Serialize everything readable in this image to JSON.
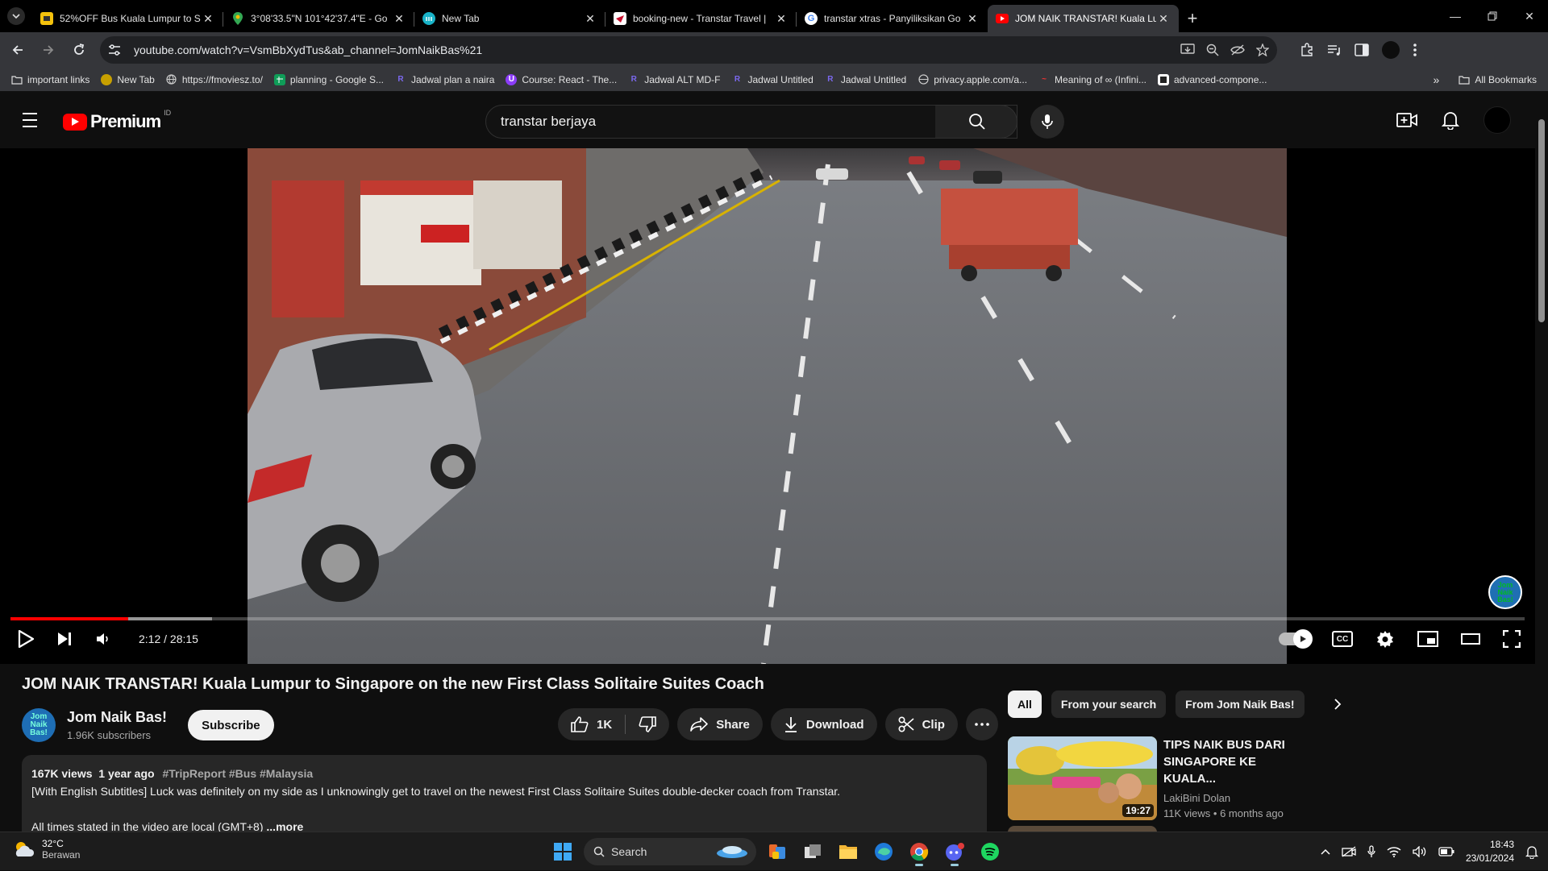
{
  "browser": {
    "tabs": [
      {
        "title": "52%OFF Bus Kuala Lumpur to S",
        "icon": "bus-ticket-favicon",
        "active": false
      },
      {
        "title": "3°08'33.5\"N 101°42'37.4\"E - Go",
        "icon": "maps-pin-favicon",
        "active": false
      },
      {
        "title": "New Tab",
        "icon": "new-tab-favicon",
        "active": false
      },
      {
        "title": "booking-new - Transtar Travel |",
        "icon": "transtar-favicon",
        "active": false
      },
      {
        "title": "transtar xtras - Panyiliksikan Go",
        "icon": "google-favicon",
        "active": false
      },
      {
        "title": "JOM NAIK TRANSTAR! Kuala Lu",
        "icon": "youtube-favicon",
        "active": true
      }
    ],
    "url": "youtube.com/watch?v=VsmBbXydTus&ab_channel=JomNaikBas%21",
    "bookmarks": [
      {
        "label": "important links",
        "icon": "folder-icon"
      },
      {
        "label": "New Tab",
        "icon": "new-tab-icon"
      },
      {
        "label": "https://fmoviesz.to/",
        "icon": "globe-icon"
      },
      {
        "label": "planning - Google S...",
        "icon": "sheets-icon"
      },
      {
        "label": "Jadwal plan a naira",
        "icon": "r-icon"
      },
      {
        "label": "Course: React - The...",
        "icon": "course-icon"
      },
      {
        "label": "Jadwal ALT MD-F",
        "icon": "r-icon"
      },
      {
        "label": "Jadwal Untitled",
        "icon": "r-icon"
      },
      {
        "label": "Jadwal Untitled",
        "icon": "r-icon"
      },
      {
        "label": "privacy.apple.com/a...",
        "icon": "globe-icon"
      },
      {
        "label": "Meaning of ∞ (Infini...",
        "icon": "dictionary-icon"
      },
      {
        "label": "advanced-compone...",
        "icon": "doc-icon"
      }
    ],
    "all_bookmarks": "All Bookmarks"
  },
  "youtube": {
    "logo_text": "Premium",
    "country_code": "ID",
    "search_value": "transtar berjaya",
    "player": {
      "current_time": "2:12",
      "duration": "28:15",
      "time_display": "2:12 / 28:15",
      "played_fraction": 0.078,
      "buffered_fraction": 0.133,
      "watermark": "Jom Naik Bas!"
    },
    "video_title": "JOM NAIK TRANSTAR! Kuala Lumpur to Singapore on the new First Class Solitaire Suites Coach",
    "channel": {
      "name": "Jom Naik Bas!",
      "subscribers": "1.96K subscribers",
      "avatar_text": "Jom Naik Bas!",
      "subscribe_label": "Subscribe"
    },
    "actions": {
      "like_count": "1K",
      "share": "Share",
      "download": "Download",
      "clip": "Clip"
    },
    "description": {
      "views": "167K views",
      "age": "1 year ago",
      "tags": "#TripReport #Bus #Malaysia",
      "line1": "[With English Subtitles] Luck was definitely on my side as I unknowingly get to travel on the newest First Class Solitaire Suites double-decker coach from Transtar.",
      "line2": "All times stated in the video are local (GMT+8)",
      "more": "...more"
    },
    "chips": [
      "All",
      "From your search",
      "From Jom Naik Bas!"
    ],
    "recommendations": [
      {
        "title": "TIPS NAIK BUS DARI SINGAPORE KE KUALA...",
        "channel": "LakiBini Dolan",
        "views": "11K views",
        "age": "6 months ago",
        "duration": "19:27"
      }
    ]
  },
  "taskbar": {
    "temperature": "32°C",
    "weather": "Berawan",
    "search_placeholder": "Search",
    "time": "18:43",
    "date": "23/01/2024"
  },
  "colors": {
    "yt_red": "#ff0000",
    "page_bg": "#0f0f0f",
    "chip_bg": "#272727"
  }
}
